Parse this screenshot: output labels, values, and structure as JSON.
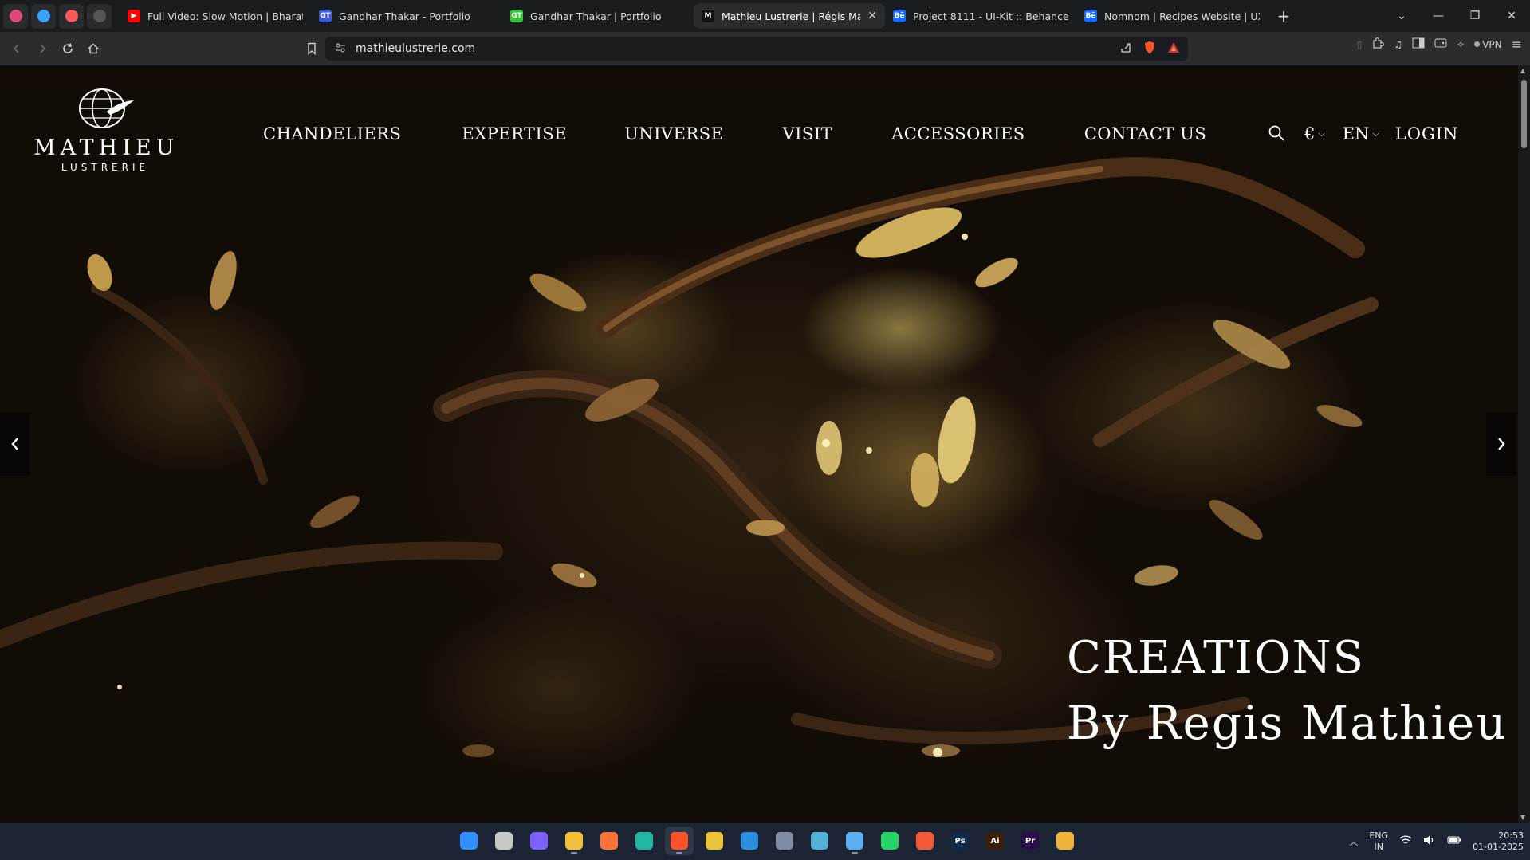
{
  "browser": {
    "pinned_tabs": [
      {
        "icon": "dribbble-icon",
        "color": "#e0457b"
      },
      {
        "icon": "wave-app-icon",
        "color": "#3aa0ff"
      },
      {
        "icon": "threads-icon",
        "color": "#ff5a5a"
      },
      {
        "icon": "pen-app-icon",
        "color": "#555555"
      }
    ],
    "tabs": [
      {
        "title": "Full Video: Slow Motion | Bharat | Sa",
        "favicon": "youtube-icon",
        "favicon_text": "▶",
        "color": "#ff0000",
        "active": false
      },
      {
        "title": "Gandhar Thakar - Portfolio",
        "favicon": "gt-logo-icon",
        "favicon_text": "GT",
        "color": "#3b5bdb",
        "active": false
      },
      {
        "title": "Gandhar Thakar | Portfolio",
        "favicon": "gt-green-icon",
        "favicon_text": "GT",
        "color": "#36c236",
        "active": false
      },
      {
        "title": "Mathieu Lustrerie | Régis Mathieu",
        "favicon": "mathieu-m-icon",
        "favicon_text": "M",
        "color": "#111111",
        "active": true
      },
      {
        "title": "Project 8111 - UI-Kit :: Behance",
        "favicon": "behance-icon",
        "favicon_text": "Bē",
        "color": "#1769ff",
        "active": false
      },
      {
        "title": "Nomnom | Recipes Website | UX/UI",
        "favicon": "behance-icon",
        "favicon_text": "Bē",
        "color": "#1769ff",
        "active": false
      }
    ],
    "url": "mathieulustrerie.com",
    "vpn_label": "VPN"
  },
  "site": {
    "logo": {
      "brand": "MATHIEU",
      "sub": "LUSTRERIE"
    },
    "nav": [
      "CHANDELIERS",
      "EXPERTISE",
      "UNIVERSE",
      "VISIT",
      "ACCESSORIES",
      "CONTACT US"
    ],
    "currency": "€",
    "language": "EN",
    "login": "LOGIN",
    "hero": {
      "line1": "CREATIONS",
      "line2": "By Regis Mathieu"
    }
  },
  "taskbar": {
    "apps": [
      {
        "name": "windows-start-icon",
        "color": "#2f8fff",
        "label": "",
        "active": false
      },
      {
        "name": "task-view-icon",
        "color": "#c8c8c8",
        "label": "",
        "active": false
      },
      {
        "name": "copilot-icon",
        "color": "#7b61ff",
        "label": "",
        "active": false
      },
      {
        "name": "file-explorer-icon",
        "color": "#f2c037",
        "label": "",
        "active": true
      },
      {
        "name": "firefox-icon",
        "color": "#ff7139",
        "label": "",
        "active": false
      },
      {
        "name": "edge-icon",
        "color": "#1fb6a4",
        "label": "",
        "active": false
      },
      {
        "name": "brave-icon",
        "color": "#fb542b",
        "label": "",
        "active": true
      },
      {
        "name": "chrome-icon",
        "color": "#eac435",
        "label": "",
        "active": false
      },
      {
        "name": "vscode-icon",
        "color": "#2a8ee0",
        "label": "",
        "active": false
      },
      {
        "name": "calculator-icon",
        "color": "#7f8ca3",
        "label": "",
        "active": false
      },
      {
        "name": "git-icon",
        "color": "#53b0d8",
        "label": "",
        "active": false
      },
      {
        "name": "notepad-icon",
        "color": "#5ab0f0",
        "label": "",
        "active": true
      },
      {
        "name": "whatsapp-icon",
        "color": "#25d366",
        "label": "",
        "active": false
      },
      {
        "name": "photos-icon",
        "color": "#f25a3a",
        "label": "",
        "active": false
      },
      {
        "name": "photoshop-icon",
        "color": "#0e2a4a",
        "label": "Ps",
        "active": false
      },
      {
        "name": "illustrator-icon",
        "color": "#3a1e05",
        "label": "Ai",
        "active": false
      },
      {
        "name": "premiere-icon",
        "color": "#2a0e4a",
        "label": "Pr",
        "active": false
      },
      {
        "name": "weather-icon",
        "color": "#f0b43a",
        "label": "",
        "active": false
      }
    ],
    "lang_top": "ENG",
    "lang_bottom": "IN",
    "time": "20:53",
    "date": "01-01-2025"
  }
}
